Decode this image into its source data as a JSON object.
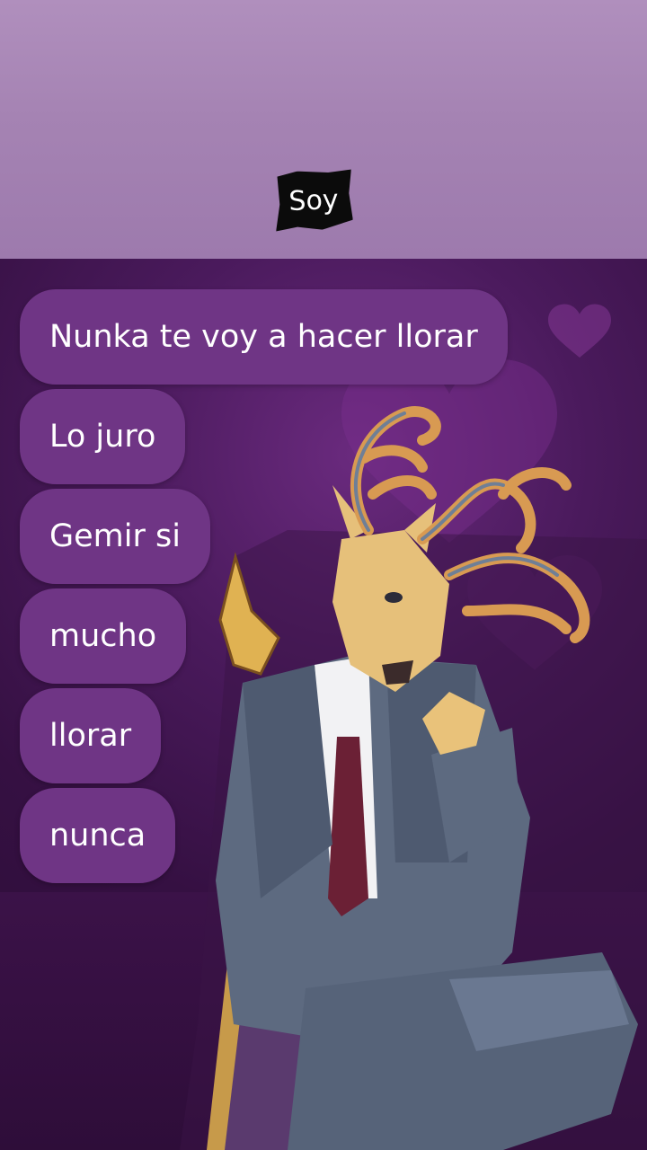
{
  "caption": "Soy",
  "messages": [
    "Nunka te voy a hacer llorar",
    "Lo juro",
    "Gemir si",
    "mucho",
    "llorar",
    "nunca"
  ],
  "colors": {
    "top_band": "#a583b3",
    "background": "#351042",
    "bubble": "#6f3585",
    "text": "#ffffff"
  }
}
